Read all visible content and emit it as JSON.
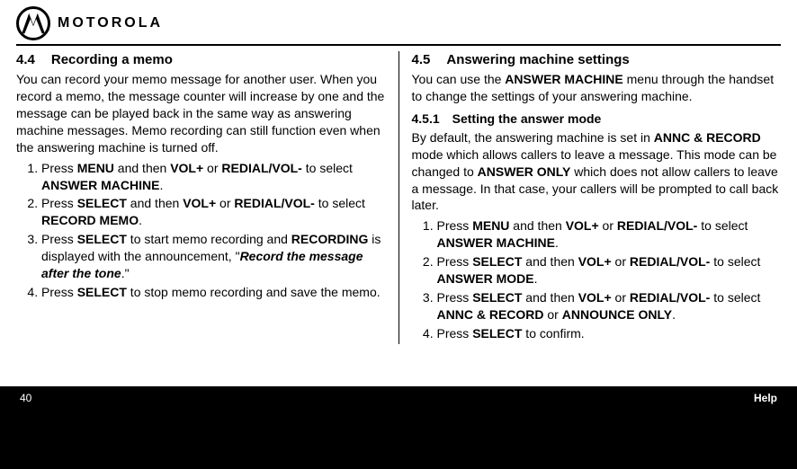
{
  "header": {
    "brand_text": "MOTOROLA"
  },
  "left": {
    "h4_num": "4.4",
    "h4_title": "Recording a memo",
    "intro": "You can record your memo message for another user. When you record a memo, the message counter will increase by one and the message can be played back in the same way as answering machine messages. Memo recording can still function even when the answering machine is turned off.",
    "steps": [
      {
        "pre": "Press ",
        "b1": "MENU",
        "mid1": " and then ",
        "b2": "VOL+",
        "mid2": " or ",
        "b3": "REDIAL/VOL-",
        "post1": " to select ",
        "b4": "ANSWER MACHINE",
        "post2": "."
      },
      {
        "pre": "Press ",
        "b1": "SELECT",
        "mid1": " and then ",
        "b2": "VOL+",
        "mid2": " or ",
        "b3": "REDIAL/VOL-",
        "post1": " to select ",
        "b4": "RECORD MEMO",
        "post2": "."
      },
      {
        "pre": "Press ",
        "b1": "SELECT",
        "mid1": " to start memo recording and ",
        "b2": "RECORDING",
        "mid2": " is displayed with the announcement, \"",
        "ib": "Record the message after the tone",
        "post1": ".\"",
        "b3": "",
        "b4": "",
        "post2": ""
      },
      {
        "pre": "Press ",
        "b1": "SELECT",
        "mid1": " to stop memo recording and save the memo.",
        "b2": "",
        "mid2": "",
        "b3": "",
        "post1": "",
        "b4": "",
        "post2": ""
      }
    ]
  },
  "right": {
    "h4_num": "4.5",
    "h4_title": "Answering machine settings",
    "intro_pre": "You can use the ",
    "intro_b1": "ANSWER MACHINE",
    "intro_post": " menu through the handset to change the settings of your answering machine.",
    "h5_num": "4.5.1",
    "h5_title": "Setting the answer mode",
    "p2a": "By default, the answering machine is set in ",
    "p2b1": "ANNC & RECORD",
    "p2b": " mode which allows callers to leave a message. This mode can be changed to ",
    "p2b2": "ANSWER ONLY",
    "p2c": " which does not allow callers to leave a message. In that case, your callers will be prompted to call back later.",
    "steps": [
      {
        "pre": "Press ",
        "b1": "MENU",
        "mid1": " and then ",
        "b2": "VOL+",
        "mid2": " or ",
        "b3": "REDIAL/VOL-",
        "post1": " to select ",
        "b4": "ANSWER MACHINE",
        "post2": "."
      },
      {
        "pre": "Press ",
        "b1": "SELECT",
        "mid1": " and then ",
        "b2": "VOL+",
        "mid2": " or ",
        "b3": "REDIAL/VOL-",
        "post1": " to select ",
        "b4": "ANSWER MODE",
        "post2": "."
      },
      {
        "pre": "Press ",
        "b1": "SELECT",
        "mid1": " and then ",
        "b2": "VOL+",
        "mid2": " or ",
        "b3": "REDIAL/VOL-",
        "post1": " to select ",
        "b4": "ANNC & RECORD",
        "post2": " or ",
        "b5": "ANNOUNCE ONLY",
        "post3": "."
      },
      {
        "pre": "Press ",
        "b1": "SELECT",
        "mid1": " to confirm.",
        "b2": "",
        "mid2": "",
        "b3": "",
        "post1": "",
        "b4": "",
        "post2": ""
      }
    ]
  },
  "footer": {
    "page_number": "40",
    "help_label": "Help"
  }
}
